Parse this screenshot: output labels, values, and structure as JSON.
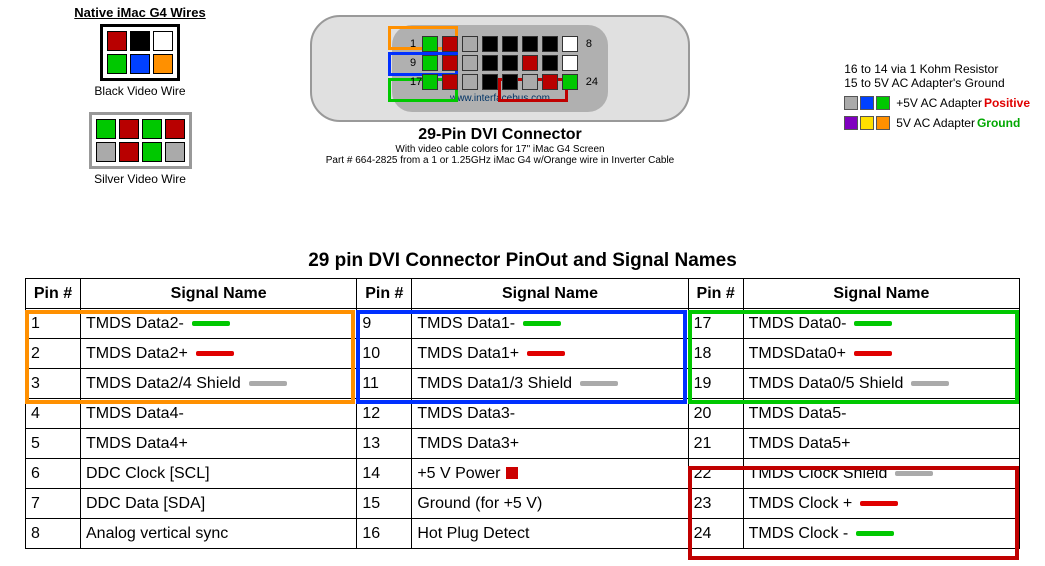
{
  "native": {
    "title": "Native iMac G4 Wires",
    "black_label": "Black Video Wire",
    "silver_label": "Silver Video Wire"
  },
  "connector": {
    "url": "www.interfacebus.com",
    "title": "29-Pin DVI Connector",
    "sub1": "With video cable colors for 17\" iMac G4 Screen",
    "sub2": "Part # 664-2825 from a 1 or 1.25GHz iMac G4 w/Orange wire in Inverter Cable",
    "pins_left": [
      "1",
      "9",
      "17"
    ],
    "pins_right": [
      "8",
      "",
      "24"
    ]
  },
  "notes": {
    "n1": "16 to 14 via 1 Kohm Resistor",
    "n2": "15 to 5V AC Adapter's Ground",
    "legend1_text": "+5V AC Adapter ",
    "legend1_em": "Positive",
    "legend2_text": "5V AC Adapter ",
    "legend2_em": "Ground"
  },
  "table": {
    "title": "29 pin DVI Connector PinOut and Signal Names",
    "headers": [
      "Pin #",
      "Signal Name",
      "Pin #",
      "Signal Name",
      "Pin #",
      "Signal Name"
    ],
    "rows": [
      {
        "p1": "1",
        "s1": "TMDS Data2-",
        "r1": "gr",
        "p2": "9",
        "s2": "TMDS Data1-",
        "r2": "gr",
        "p3": "17",
        "s3": "TMDS Data0-",
        "r3": "gr"
      },
      {
        "p1": "2",
        "s1": "TMDS Data2+",
        "r1": "rd",
        "p2": "10",
        "s2": "TMDS Data1+",
        "r2": "rd",
        "p3": "18",
        "s3": "TMDSData0+",
        "r3": "rd"
      },
      {
        "p1": "3",
        "s1": "TMDS Data2/4 Shield",
        "r1": "gy",
        "p2": "11",
        "s2": "TMDS Data1/3 Shield",
        "r2": "gy",
        "p3": "19",
        "s3": "TMDS Data0/5 Shield",
        "r3": "gy"
      },
      {
        "p1": "4",
        "s1": "TMDS Data4-",
        "r1": "",
        "p2": "12",
        "s2": "TMDS Data3-",
        "r2": "",
        "p3": "20",
        "s3": "TMDS Data5-",
        "r3": ""
      },
      {
        "p1": "5",
        "s1": "TMDS Data4+",
        "r1": "",
        "p2": "13",
        "s2": "TMDS Data3+",
        "r2": "",
        "p3": "21",
        "s3": "TMDS Data5+",
        "r3": ""
      },
      {
        "p1": "6",
        "s1": "DDC Clock [SCL]",
        "r1": "",
        "p2": "14",
        "s2": "+5 V Power",
        "r2": "dot",
        "p3": "22",
        "s3": "TMDS Clock Shield",
        "r3": "gy"
      },
      {
        "p1": "7",
        "s1": "DDC Data [SDA]",
        "r1": "",
        "p2": "15",
        "s2": "Ground (for +5 V)",
        "r2": "",
        "p3": "23",
        "s3": "TMDS Clock +",
        "r3": "rd"
      },
      {
        "p1": "8",
        "s1": "Analog vertical sync",
        "r1": "",
        "p2": "16",
        "s2": "Hot Plug Detect",
        "r2": "",
        "p3": "24",
        "s3": "TMDS Clock -",
        "r3": "gr"
      }
    ]
  }
}
